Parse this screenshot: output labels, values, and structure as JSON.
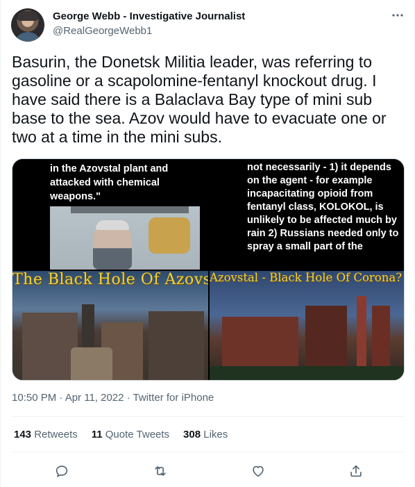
{
  "author": {
    "name": "George Webb - Investigative Journalist",
    "handle": "@RealGeorgeWebb1"
  },
  "more_icon": "more-horizontal-icon",
  "tweet_text": "Basurin, the Donetsk Militia leader, was referring to gasoline or a scapolomine-fentanyl knockout drug. I have said there is a Balaclava Bay type of mini sub base to the sea. Azov would have to evacuate one or two at a time in the mini subs.",
  "media": {
    "img1_text": "in the Azovstal plant and attacked with chemical weapons.\"",
    "img2_text": "not necessarily - 1) it depends on the agent - for example incapacitating opioid from fentanyl class, KOLOKOL, is unlikely to be affected much by rain 2) Russians needed only to spray a small part of the",
    "img3_title": "The Black Hole Of Azovstal",
    "img4_title": "Azovstal - Black Hole Of Corona?"
  },
  "meta": {
    "timestamp": "10:50 PM · Apr 11, 2022 · Twitter for iPhone"
  },
  "stats": {
    "retweets_count": "143",
    "retweets_label": "Retweets",
    "quotes_count": "11",
    "quotes_label": "Quote Tweets",
    "likes_count": "308",
    "likes_label": "Likes"
  },
  "actions": {
    "reply_icon": "reply-icon",
    "retweet_icon": "retweet-icon",
    "like_icon": "heart-icon",
    "share_icon": "share-icon"
  },
  "colors": {
    "text": "#0f1419",
    "secondary": "#536471",
    "border": "#eff3f4",
    "title_yellow": "#f3d23a"
  }
}
